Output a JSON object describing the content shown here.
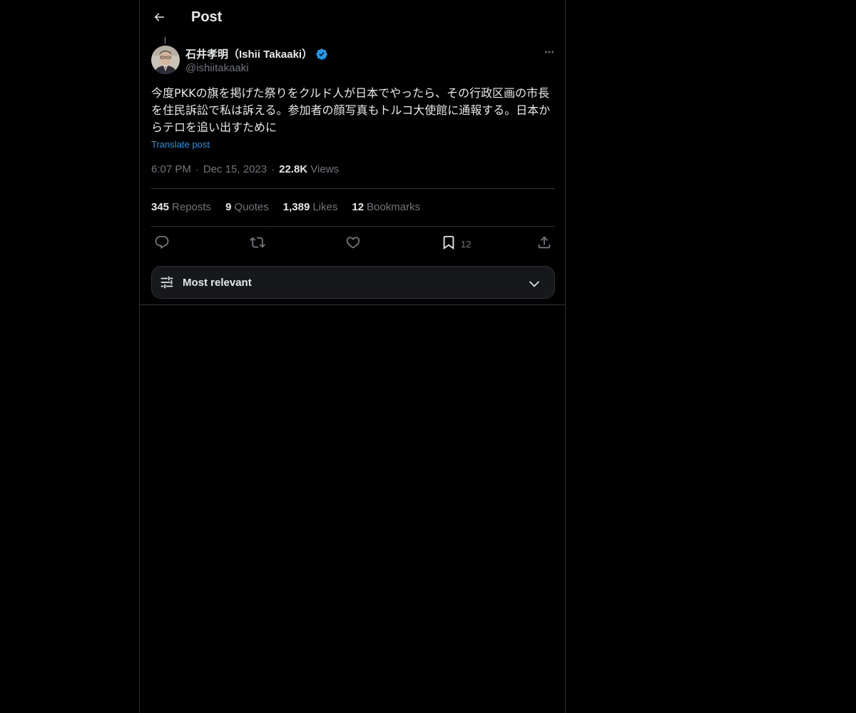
{
  "header": {
    "title": "Post",
    "back_icon": "arrow-left-icon"
  },
  "post": {
    "author": {
      "name": "石井孝明（Ishii Takaaki）",
      "handle": "@ishiitakaaki",
      "verified": true,
      "verified_color": "#1d9bf0"
    },
    "text": "今度PKKの旗を掲げた祭りをクルド人が日本でやったら、その行政区画の市長を住民訴訟で私は訴える。参加者の顔写真もトルコ大使館に通報する。日本からテロを追い出すために",
    "translate_label": "Translate post",
    "time": "6:07 PM",
    "date": "Dec 15, 2023",
    "separator": "·",
    "views_count": "22.8K",
    "views_label": "Views"
  },
  "stats": {
    "reposts": {
      "count": "345",
      "label": "Reposts"
    },
    "quotes": {
      "count": "9",
      "label": "Quotes"
    },
    "likes": {
      "count": "1,389",
      "label": "Likes"
    },
    "bookmarks": {
      "count": "12",
      "label": "Bookmarks"
    }
  },
  "actions": {
    "reply_icon": "reply-icon",
    "repost_icon": "repost-icon",
    "like_icon": "heart-icon",
    "bookmark_icon": "bookmark-icon",
    "bookmark_count": "12",
    "share_icon": "share-icon"
  },
  "sort": {
    "label": "Most relevant",
    "icon": "sliders-icon",
    "chevron": "chevron-down-icon"
  },
  "colors": {
    "background": "#000000",
    "text_primary": "#e7e9ea",
    "text_secondary": "#71767b",
    "accent": "#1d9bf0",
    "border": "#2f3336"
  }
}
